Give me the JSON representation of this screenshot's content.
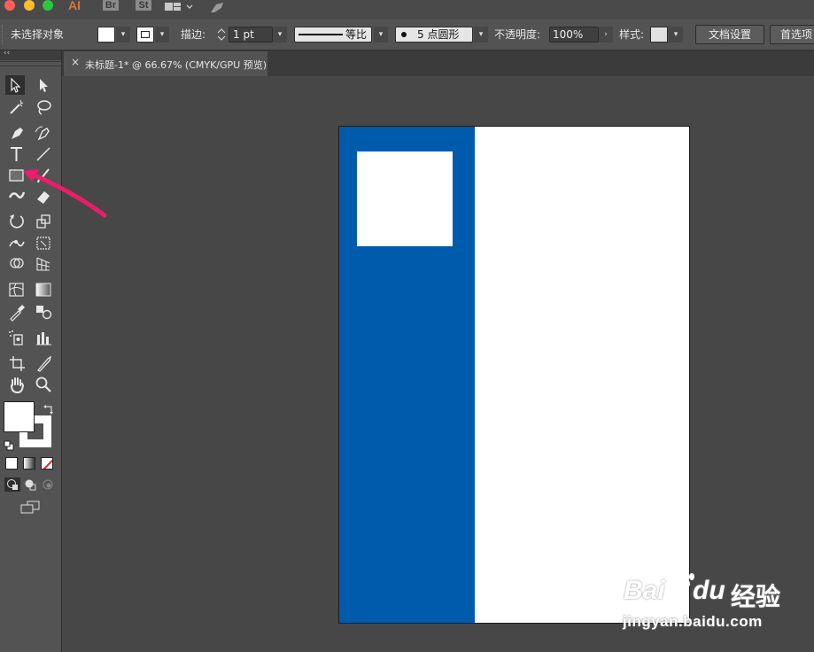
{
  "colors": {
    "artboard_blue": "#005bac",
    "annotation_arrow": "#ec1d6a",
    "traffic_close": "#fd5f57",
    "traffic_min": "#febc2e",
    "traffic_max": "#28c840",
    "app_ai": "#d27a36"
  },
  "menubar": {
    "app_label": "AI",
    "bridge_label": "Br",
    "stock_label": "St"
  },
  "control_bar": {
    "selection_status": "未选择对象",
    "stroke_label": "描边:",
    "stroke_weight": "1 pt",
    "profile_label": "等比",
    "brush_label": "5 点圆形",
    "opacity_label": "不透明度:",
    "opacity_value": "100%",
    "style_label": "样式:",
    "doc_setup_button": "文档设置",
    "preferences_button": "首选项"
  },
  "document_tab": {
    "close_glyph": "×",
    "title": "未标题-1* @ 66.67% (CMYK/GPU 预览)"
  },
  "toolbar": {
    "collapse_glyph": "‹‹",
    "tools": [
      "selection-tool-icon",
      "direct-selection-tool-icon",
      "magic-wand-tool-icon",
      "lasso-tool-icon",
      "pen-tool-icon",
      "curvature-tool-icon",
      "type-tool-icon",
      "line-segment-tool-icon",
      "rectangle-tool-icon",
      "paintbrush-tool-icon",
      "shaper-tool-icon",
      "eraser-tool-icon",
      "rotate-tool-icon",
      "scale-tool-icon",
      "width-tool-icon",
      "free-transform-tool-icon",
      "shape-builder-tool-icon",
      "perspective-grid-tool-icon",
      "mesh-tool-icon",
      "gradient-tool-icon",
      "eyedropper-tool-icon",
      "blend-tool-icon",
      "symbol-sprayer-tool-icon",
      "column-graph-tool-icon",
      "artboard-tool-icon",
      "slice-tool-icon",
      "hand-tool-icon",
      "zoom-tool-icon"
    ]
  },
  "watermark": {
    "brand_prefix": "Bai",
    "brand_suffix": "du",
    "brand_cn": "经验",
    "url": "jingyan.baidu.com"
  }
}
